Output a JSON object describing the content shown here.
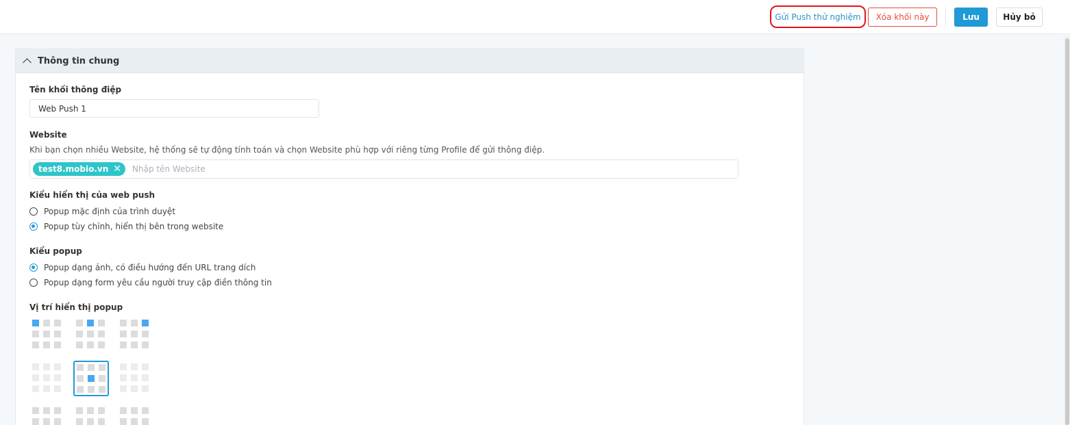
{
  "toolbar": {
    "send_test": "Gửi Push thử nghiệm",
    "delete": "Xóa khối này",
    "save": "Lưu",
    "cancel": "Hủy bỏ"
  },
  "panel": {
    "title": "Thông tin chung",
    "name_label": "Tên khối thông điệp",
    "name_value": "Web Push 1",
    "website_label": "Website",
    "website_desc": "Khi bạn chọn nhiều Website, hệ thống sẽ tự động tính toán và chọn Website phù hợp với riêng từng Profile để gửi thông điệp.",
    "website_tag": "test8.mobio.vn",
    "website_placeholder": "Nhập tên Website",
    "display_label": "Kiểu hiển thị của web push",
    "display_options": [
      "Popup mặc định của trình duyệt",
      "Popup tùy chỉnh, hiển thị bên trong website"
    ],
    "display_selected": 1,
    "popup_label": "Kiểu popup",
    "popup_options": [
      "Popup dạng ảnh, có điều hướng đến URL trang dích",
      "Popup dạng form yêu cầu người truy cập điền thông tin"
    ],
    "popup_selected": 0,
    "position_label": "Vị trí hiển thị popup",
    "position_selected": "center"
  },
  "colors": {
    "primary": "#1f9ad6",
    "danger": "#e74c3c",
    "tag": "#2ec5c9",
    "highlight": "#e0141a"
  }
}
